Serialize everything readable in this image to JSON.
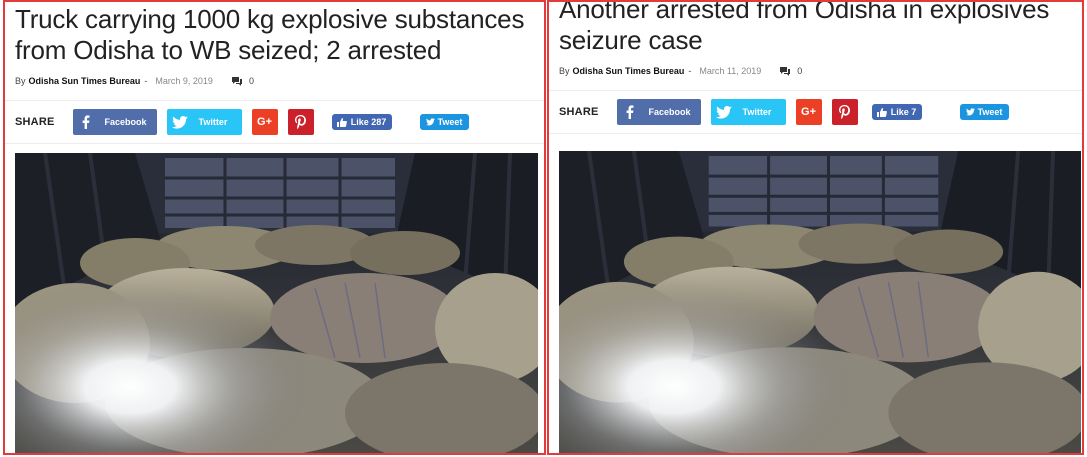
{
  "panels": [
    {
      "headline": "Truck carrying 1000 kg explosive substances from Odisha to WB seized; 2 arrested",
      "headline_line1": "Truck carrying 1000 kg explosive substances",
      "headline_line2": "from Odisha to WB seized; 2 arrested",
      "byline": {
        "by": "By",
        "author": "Odisha Sun Times Bureau",
        "sep": "-",
        "date": "March 9, 2019",
        "comments": "0"
      },
      "share": {
        "label": "SHARE",
        "facebook": "Facebook",
        "twitter": "Twitter",
        "fb_like": "Like 287",
        "tweet": "Tweet"
      }
    },
    {
      "headline": "Another arrested from Odisha in explosives seizure case",
      "headline_line1": "Another arrested from Odisha in explosives",
      "headline_line2": "seizure case",
      "byline": {
        "by": "By",
        "author": "Odisha Sun Times Bureau",
        "sep": "-",
        "date": "March 11, 2019",
        "comments": "0"
      },
      "share": {
        "label": "SHARE",
        "facebook": "Facebook",
        "twitter": "Twitter",
        "fb_like": "Like 7",
        "tweet": "Tweet"
      }
    }
  ],
  "icons": {
    "comment": "comment-icon",
    "facebook": "facebook-icon",
    "twitter": "twitter-icon",
    "googleplus": "google-plus-icon",
    "pinterest": "pinterest-icon",
    "like": "thumbs-up-icon"
  },
  "colors": {
    "frame": "#e23b3b",
    "facebook": "#516eab",
    "twitter": "#29c5f6",
    "googleplus": "#eb4026",
    "pinterest": "#ca212a"
  }
}
